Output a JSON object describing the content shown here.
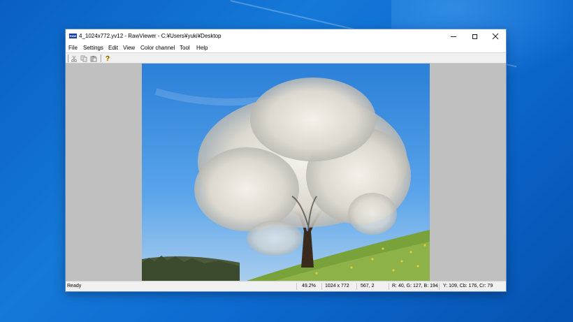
{
  "window": {
    "title": "4_1024x772.yv12 - RawViewer - C:¥Users¥yuki¥Desktop",
    "icon_label": "RAW"
  },
  "menu": [
    "File",
    "Settings",
    "Edit",
    "View",
    "Color channel",
    "Tool",
    "Help"
  ],
  "toolbar": {
    "buttons": [
      "cut-icon",
      "copy-icon",
      "paste-icon",
      "help-icon"
    ]
  },
  "image": {
    "description_icon": "tree-photo"
  },
  "status": {
    "ready": "Ready",
    "zoom": "49.2%",
    "dimensions": "1024 x 772",
    "position": "567, 2",
    "rgb": "R: 40, G: 127, B: 194",
    "ycbcr": "Y: 109, Cb: 176, Cr: 79"
  },
  "colors": {
    "desktop": "#1479d8",
    "client_bg": "#c0c0c0",
    "sky": "#3b8fe0",
    "grass": "#7aa23a"
  }
}
